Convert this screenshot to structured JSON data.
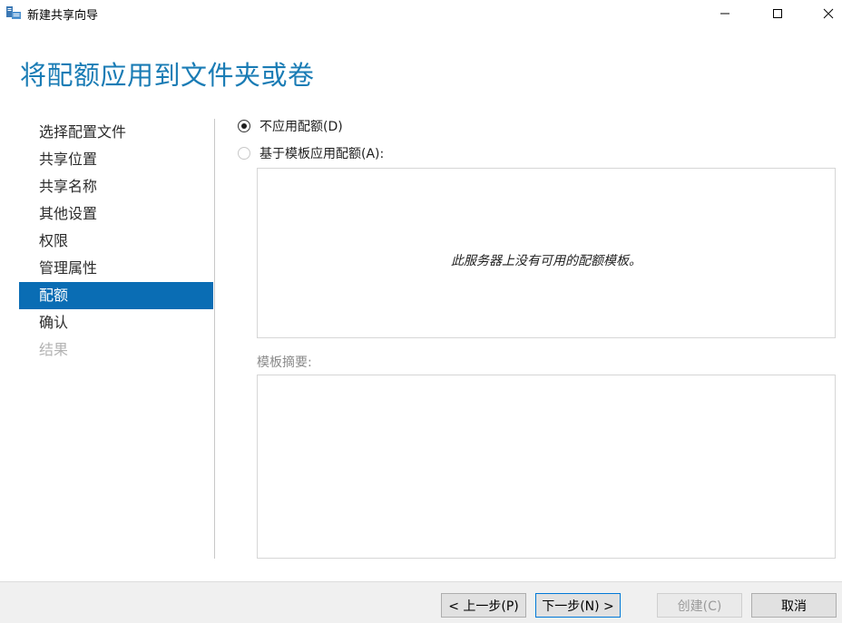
{
  "window": {
    "title": "新建共享向导",
    "icon": "share-wizard-icon",
    "controls": [
      "minimize-icon",
      "maximize-icon",
      "close-icon"
    ]
  },
  "page": {
    "heading": "将配额应用到文件夹或卷"
  },
  "steps": [
    {
      "label": "选择配置文件",
      "state": "normal"
    },
    {
      "label": "共享位置",
      "state": "normal"
    },
    {
      "label": "共享名称",
      "state": "normal"
    },
    {
      "label": "其他设置",
      "state": "normal"
    },
    {
      "label": "权限",
      "state": "normal"
    },
    {
      "label": "管理属性",
      "state": "normal"
    },
    {
      "label": "配额",
      "state": "active"
    },
    {
      "label": "确认",
      "state": "normal"
    },
    {
      "label": "结果",
      "state": "disabled"
    }
  ],
  "options": {
    "no_quota": {
      "label": "不应用配额(D)",
      "checked": true
    },
    "template_quota": {
      "label": "基于模板应用配额(A):",
      "checked": false
    }
  },
  "template_list": {
    "empty_message": "此服务器上没有可用的配额模板。"
  },
  "summary": {
    "label": "模板摘要:",
    "content": ""
  },
  "footer": {
    "prev_label": "< 上一步(P)",
    "next_label": "下一步(N) >",
    "create_label": "创建(C)",
    "cancel_label": "取消"
  },
  "colors": {
    "heading": "#1a7cb5",
    "active_step_bg": "#0a6db4",
    "primary_button_border": "#0078d7"
  }
}
